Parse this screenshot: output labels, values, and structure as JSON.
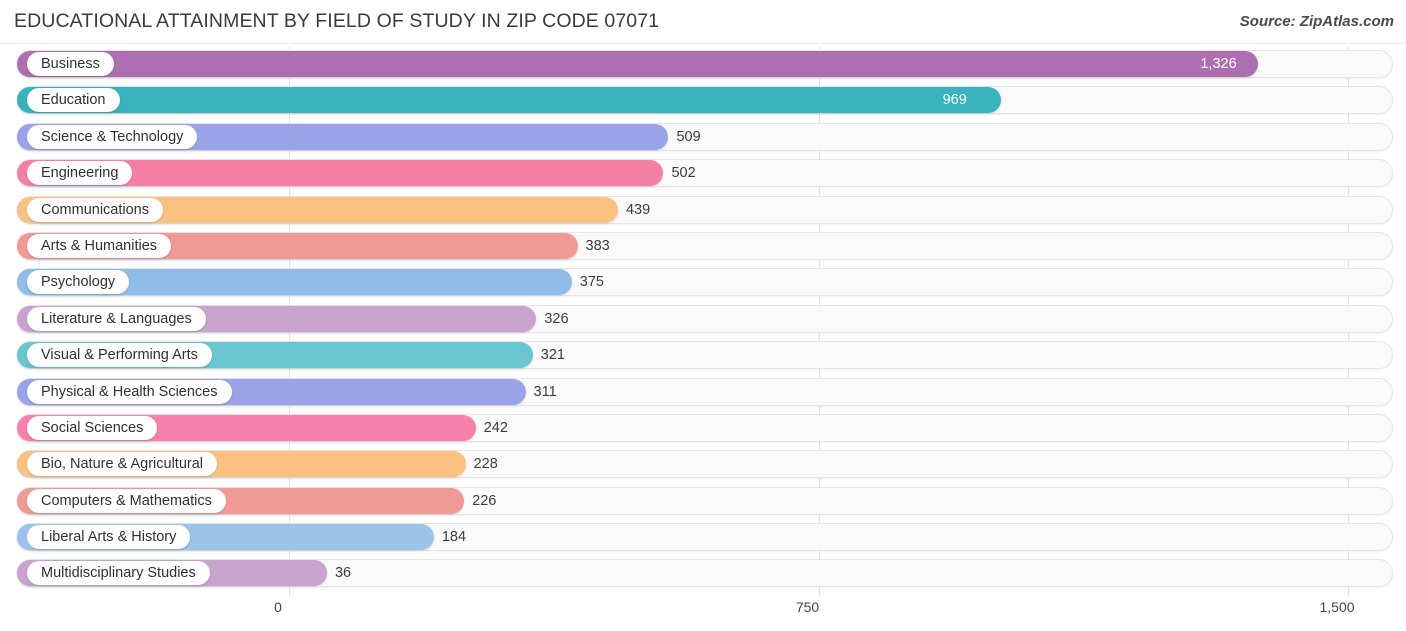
{
  "header": {
    "title": "EDUCATIONAL ATTAINMENT BY FIELD OF STUDY IN ZIP CODE 07071",
    "source": "Source: ZipAtlas.com"
  },
  "chart_data": {
    "type": "bar",
    "orientation": "horizontal",
    "title": "EDUCATIONAL ATTAINMENT BY FIELD OF STUDY IN ZIP CODE 07071",
    "xlabel": "",
    "ylabel": "",
    "xlim": [
      0,
      1500
    ],
    "grid": true,
    "legend": "none",
    "xticks": [
      "0",
      "750",
      "1,500"
    ],
    "xtick_values": [
      0,
      750,
      1500
    ],
    "categories": [
      "Business",
      "Education",
      "Science & Technology",
      "Engineering",
      "Communications",
      "Arts & Humanities",
      "Psychology",
      "Literature & Languages",
      "Visual & Performing Arts",
      "Physical & Health Sciences",
      "Social Sciences",
      "Bio, Nature & Agricultural",
      "Computers & Mathematics",
      "Liberal Arts & History",
      "Multidisciplinary Studies"
    ],
    "values": [
      1326,
      969,
      509,
      502,
      439,
      383,
      375,
      326,
      321,
      311,
      242,
      228,
      226,
      184,
      36
    ],
    "value_labels": [
      "1,326",
      "969",
      "509",
      "502",
      "439",
      "383",
      "375",
      "326",
      "321",
      "311",
      "242",
      "228",
      "226",
      "184",
      "36"
    ],
    "colors": [
      "#ad6fb0",
      "#38b2bc",
      "#9ba3e8",
      "#f57fa5",
      "#fbc183",
      "#f09a96",
      "#8fbce8",
      "#c7a3ce",
      "#69c5ce",
      "#9ba3e8",
      "#f881ab",
      "#fbc183",
      "#f09a96",
      "#9dc3ea",
      "#c7a3ce"
    ],
    "label_inside": [
      true,
      true,
      false,
      false,
      false,
      false,
      false,
      false,
      false,
      false,
      false,
      false,
      false,
      false,
      false
    ]
  },
  "theme": {
    "background": "#ffffff",
    "track": "#fafafa",
    "track_border": "#e4e4e4",
    "gridline": "#e3e3e3",
    "text": "#3a3a3a"
  }
}
